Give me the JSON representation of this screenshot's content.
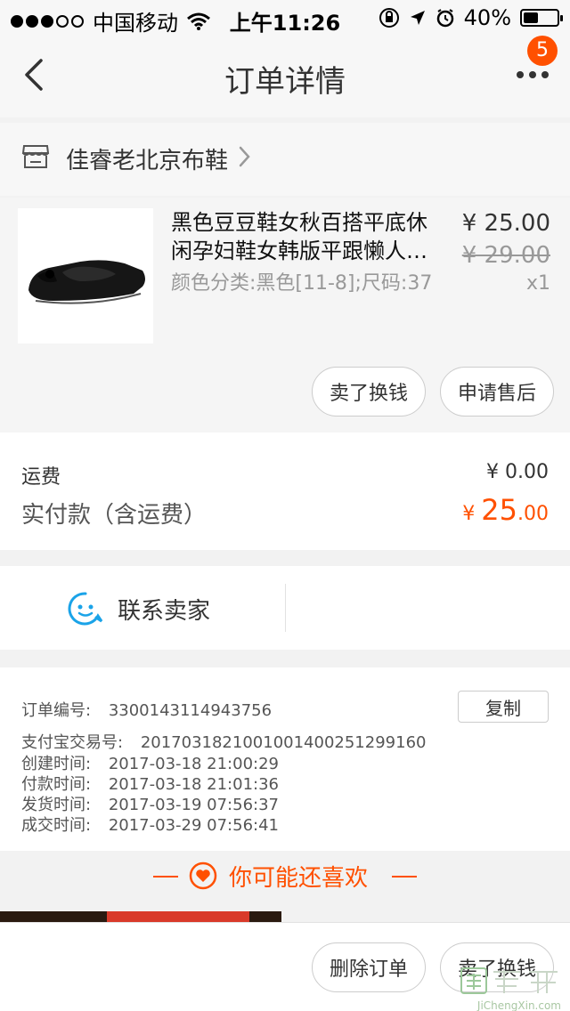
{
  "status_bar": {
    "carrier": "中国移动",
    "time": "上午11:26",
    "battery": "40%"
  },
  "navbar": {
    "title": "订单详情",
    "badge": "5"
  },
  "shop": {
    "name": "佳睿老北京布鞋"
  },
  "product": {
    "title_line1": "黑色豆豆鞋女秋百搭平底休",
    "title_line2": "闲孕妇鞋女韩版平跟懒人…",
    "sku": "颜色分类:黑色[11-8];尺码:37",
    "price": "¥ 25.00",
    "original_price": "¥ 29.00",
    "quantity": "x1",
    "actions": [
      "卖了换钱",
      "申请售后"
    ]
  },
  "fees": {
    "shipping_label": "运费",
    "shipping_value": "¥ 0.00",
    "paid_label": "实付款（含运费）",
    "paid_symbol": "¥ ",
    "paid_int": "25",
    "paid_dec": ".00"
  },
  "contact": {
    "label": "联系卖家"
  },
  "order_info": {
    "copy_label": "复制",
    "rows": [
      {
        "label": "订单编号:",
        "value": "3300143114943756"
      },
      {
        "label": "支付宝交易号:",
        "value": "2017031821001001400251299160"
      },
      {
        "label": "创建时间:",
        "value": "2017-03-18 21:00:29"
      },
      {
        "label": "付款时间:",
        "value": "2017-03-18 21:01:36"
      },
      {
        "label": "发货时间:",
        "value": "2017-03-19 07:56:37"
      },
      {
        "label": "成交时间:",
        "value": "2017-03-29 07:56:41"
      }
    ]
  },
  "recommend": {
    "title": "你可能还喜欢"
  },
  "bottom_bar": {
    "actions": [
      "删除订单",
      "卖了换钱"
    ]
  },
  "watermark": {
    "text": "JiChengXin.com"
  },
  "colors": {
    "accent": "#ff5000",
    "contact_icon": "#1aa3e8"
  }
}
